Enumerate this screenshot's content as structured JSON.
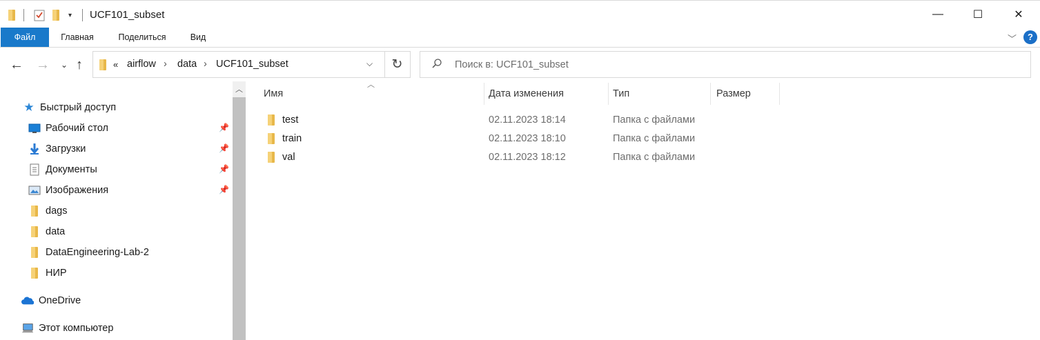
{
  "window": {
    "title": "UCF101_subset",
    "minimize": "—",
    "maximize": "☐",
    "close": "✕"
  },
  "ribbon": {
    "tabs": [
      "Файл",
      "Главная",
      "Поделиться",
      "Вид"
    ],
    "help": "?",
    "accent": "#1979ca"
  },
  "address": {
    "overflow": "«",
    "crumbs": [
      "airflow",
      "data",
      "UCF101_subset"
    ]
  },
  "search": {
    "placeholder": "Поиск в: UCF101_subset"
  },
  "sidebar": {
    "quick_access": "Быстрый доступ",
    "items": [
      {
        "label": "Рабочий стол",
        "icon": "desktop-icon",
        "pinned": true
      },
      {
        "label": "Загрузки",
        "icon": "download-icon",
        "pinned": true
      },
      {
        "label": "Документы",
        "icon": "documents-icon",
        "pinned": true
      },
      {
        "label": "Изображения",
        "icon": "pictures-icon",
        "pinned": true
      },
      {
        "label": "dags",
        "icon": "folder-icon",
        "pinned": false
      },
      {
        "label": "data",
        "icon": "folder-icon",
        "pinned": false
      },
      {
        "label": "DataEngineering-Lab-2",
        "icon": "folder-icon",
        "pinned": false
      },
      {
        "label": "НИР",
        "icon": "folder-icon",
        "pinned": false
      }
    ],
    "onedrive": "OneDrive",
    "this_pc": "Этот компьютер"
  },
  "columns": {
    "name": "Имя",
    "date": "Дата изменения",
    "type": "Тип",
    "size": "Размер"
  },
  "files": [
    {
      "name": "test",
      "date": "02.11.2023 18:14",
      "type": "Папка с файлами"
    },
    {
      "name": "train",
      "date": "02.11.2023 18:10",
      "type": "Папка с файлами"
    },
    {
      "name": "val",
      "date": "02.11.2023 18:12",
      "type": "Папка с файлами"
    }
  ]
}
